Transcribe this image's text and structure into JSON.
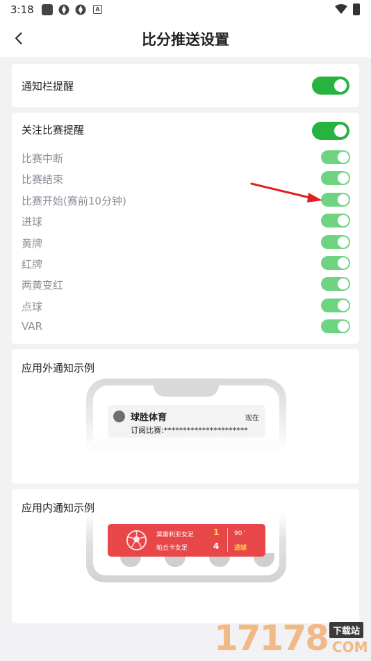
{
  "status_bar": {
    "time": "3:18",
    "badge_letter": "A"
  },
  "header": {
    "title": "比分推送设置"
  },
  "notification_bar": {
    "label": "通知栏提醒",
    "enabled": true
  },
  "followed_matches": {
    "label": "关注比赛提醒",
    "enabled": true,
    "items": [
      {
        "label": "比赛中断",
        "enabled": true
      },
      {
        "label": "比赛结束",
        "enabled": true
      },
      {
        "label": "比赛开始(赛前10分钟)",
        "enabled": true
      },
      {
        "label": "进球",
        "enabled": true
      },
      {
        "label": "黄牌",
        "enabled": true
      },
      {
        "label": "红牌",
        "enabled": true
      },
      {
        "label": "两黄变红",
        "enabled": true
      },
      {
        "label": "点球",
        "enabled": true
      },
      {
        "label": "VAR",
        "enabled": true
      }
    ]
  },
  "outside_example": {
    "title": "应用外通知示例",
    "app_name": "球胜体育",
    "time": "现在",
    "body": "订阅比赛:**********************"
  },
  "inside_example": {
    "title": "应用内通知示例",
    "team1": "莫雷利亚女足",
    "team2": "帕丘卡女足",
    "score1": "1",
    "score2": "4",
    "minute": "90 '",
    "event": "进球"
  },
  "watermark": {
    "number": "17178",
    "tag": "下载站",
    "domain": "COM"
  },
  "colors": {
    "toggle_on": "#27b340",
    "toggle_on_light": "#6fd482",
    "banner_red": "#e8474a",
    "arrow_red": "#e02020"
  }
}
